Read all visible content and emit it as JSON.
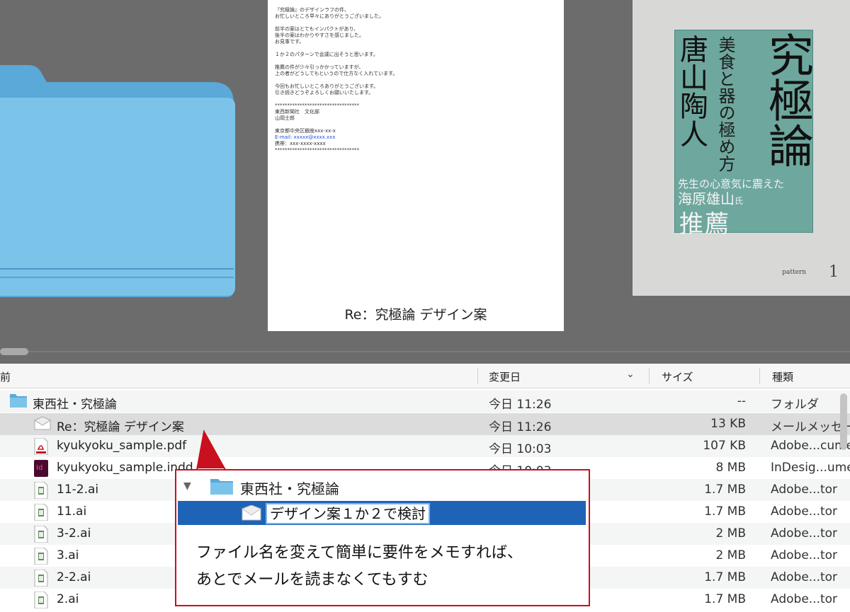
{
  "gallery": {
    "email_preview": {
      "body_lines": [
        "『究極論』のデザインラフの件、",
        "お忙しいところ早々にありがとうございました。",
        "",
        "前半の案はとてもインパクトがあり、",
        "後半の案はわかりやすさを感じました。",
        "お見事です。",
        "",
        "１か２のパターンで会議に出そうと思います。",
        "",
        "推薦の件が少々引っかかっていますが、",
        "上の者がどうしてもというので仕方なく入れています。",
        "",
        "今回もお忙しいところありがとうございます。",
        "引き続きどうぞよろしくお願いいたします。",
        "",
        "**********************************",
        "東西新聞社　文化部",
        "山岡士郎",
        "",
        "東京都中央区銀座xxx-xx-x",
        "E-mail: xxxxx@xxxx.xxx",
        "携帯：xxx-xxxx-xxxx",
        "**********************************"
      ],
      "caption": "Re：究極論 デザイン案"
    },
    "book_preview": {
      "title": "究極論",
      "subtitle": "美食と器の極め方",
      "author": "唐山陶人",
      "recommend_line1": "先生の心意気に震えた",
      "recommend_name": "海原雄山",
      "recommend_honorific": "氏",
      "recommend_line3": "推薦",
      "footer_label": "pattern",
      "footer_number": "1"
    }
  },
  "list": {
    "headers": {
      "name": "前",
      "date": "変更日",
      "size": "サイズ",
      "kind": "種類"
    },
    "rows": [
      {
        "icon": "folder-icon",
        "name": "東西社・究極論",
        "date": "今日 11:26",
        "size": "--",
        "kind": "フォルダ"
      },
      {
        "icon": "mail-icon",
        "name": "Re：究極論 デザイン案",
        "date": "今日 11:26",
        "size": "13 KB",
        "kind": "メールメッセージ"
      },
      {
        "icon": "pdf-icon",
        "name": "kyukyoku_sample.pdf",
        "date": "今日 10:03",
        "size": "107 KB",
        "kind": "Adobe...cument"
      },
      {
        "icon": "indd-icon",
        "name": "kyukyoku_sample.indd",
        "date": "今日 10:03",
        "size": "8 MB",
        "kind": "InDesig...ument"
      },
      {
        "icon": "ai-icon",
        "name": "11-2.ai",
        "date": "",
        "size": "1.7 MB",
        "kind": "Adobe...tor"
      },
      {
        "icon": "ai-icon",
        "name": "11.ai",
        "date": "",
        "size": "1.7 MB",
        "kind": "Adobe...tor"
      },
      {
        "icon": "ai-icon",
        "name": "3-2.ai",
        "date": "",
        "size": "2 MB",
        "kind": "Adobe...tor"
      },
      {
        "icon": "ai-icon",
        "name": "3.ai",
        "date": "",
        "size": "2 MB",
        "kind": "Adobe...tor"
      },
      {
        "icon": "ai-icon",
        "name": "2-2.ai",
        "date": "",
        "size": "1.7 MB",
        "kind": "Adobe...tor"
      },
      {
        "icon": "ai-icon",
        "name": "2.ai",
        "date": "",
        "size": "1.7 MB",
        "kind": "Adobe...tor"
      }
    ]
  },
  "callout": {
    "folder_name": "東西社・究極論",
    "rename_value": "デザイン案１か２で検討",
    "note_line1": "ファイル名を変えて簡単に要件をメモすれば、",
    "note_line2": "あとでメールを読まなくてもすむ",
    "border_color": "#c8101e",
    "selection_color": "#1e63b5"
  }
}
